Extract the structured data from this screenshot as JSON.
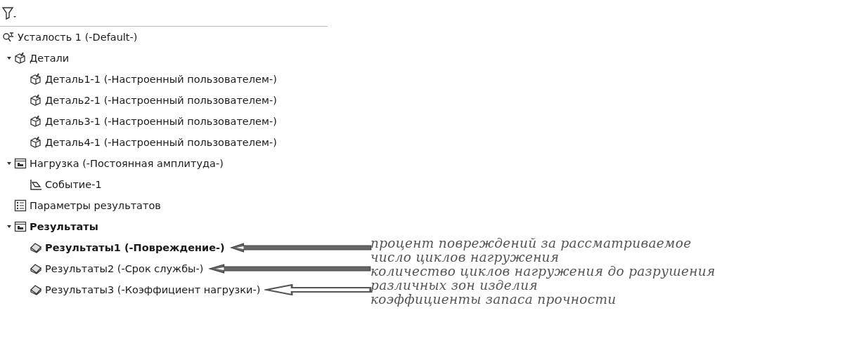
{
  "tree": [
    {
      "label": "Усталость 1 (-Default-)",
      "kind": "study",
      "bold": false,
      "children": [
        {
          "label": "Детали",
          "kind": "parts",
          "bold": false,
          "expanded": true,
          "children": [
            {
              "label": "Деталь1-1 (-Настроенный пользователем-)",
              "kind": "part",
              "bold": false
            },
            {
              "label": "Деталь2-1 (-Настроенный пользователем-)",
              "kind": "part",
              "bold": false
            },
            {
              "label": "Деталь3-1 (-Настроенный пользователем-)",
              "kind": "part",
              "bold": false
            },
            {
              "label": "Деталь4-1 (-Настроенный пользователем-)",
              "kind": "part",
              "bold": false
            }
          ]
        },
        {
          "label": "Нагрузка (-Постоянная амплитуда-)",
          "kind": "folder",
          "bold": false,
          "expanded": true,
          "children": [
            {
              "label": "Событие-1",
              "kind": "event",
              "bold": false
            }
          ]
        },
        {
          "label": "Параметры результатов",
          "kind": "options",
          "bold": false
        },
        {
          "label": "Результаты",
          "kind": "folder",
          "bold": true,
          "expanded": true,
          "children": [
            {
              "label": "Результаты1 (-Повреждение-)",
              "kind": "plot",
              "bold": true,
              "callout": {
                "kind": "thick"
              }
            },
            {
              "label": "Результаты2 (-Срок службы-)",
              "kind": "plot",
              "bold": false,
              "callout": {
                "kind": "thick"
              }
            },
            {
              "label": "Результаты3 (-Коэффициент нагрузки-)",
              "kind": "plot",
              "bold": false,
              "callout": {
                "kind": "open"
              }
            }
          ]
        }
      ]
    }
  ],
  "annotations": [
    "процент повреждений за рассматриваемое\nчисло циклов нагружения",
    "количество циклов нагружения до разрушения\nразличных зон изделия",
    "коэффициенты запаса прочности"
  ]
}
